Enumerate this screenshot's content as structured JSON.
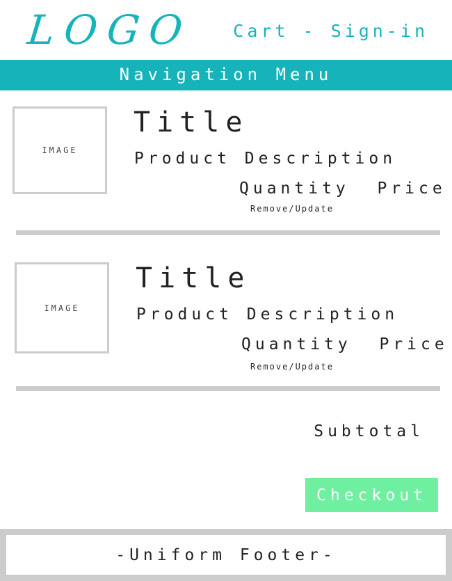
{
  "header": {
    "logo": "LOGO",
    "cart_label": "Cart",
    "separator": " - ",
    "signin_label": "Sign-in"
  },
  "nav": {
    "label": "Navigation Menu"
  },
  "items": [
    {
      "image_label": "IMAGE",
      "title": "Title",
      "description": "Product Description",
      "quantity_label": "Quantity",
      "price_label": "Price",
      "remove_update_label": "Remove/Update"
    },
    {
      "image_label": "IMAGE",
      "title": "Title",
      "description": "Product Description",
      "quantity_label": "Quantity",
      "price_label": "Price",
      "remove_update_label": "Remove/Update"
    }
  ],
  "summary": {
    "subtotal_label": "Subtotal",
    "checkout_label": "Checkout"
  },
  "footer": {
    "label": "-Uniform Footer-"
  },
  "colors": {
    "accent": "#17b3bb",
    "checkout": "#6ef0a0",
    "divider": "#cccccc"
  }
}
